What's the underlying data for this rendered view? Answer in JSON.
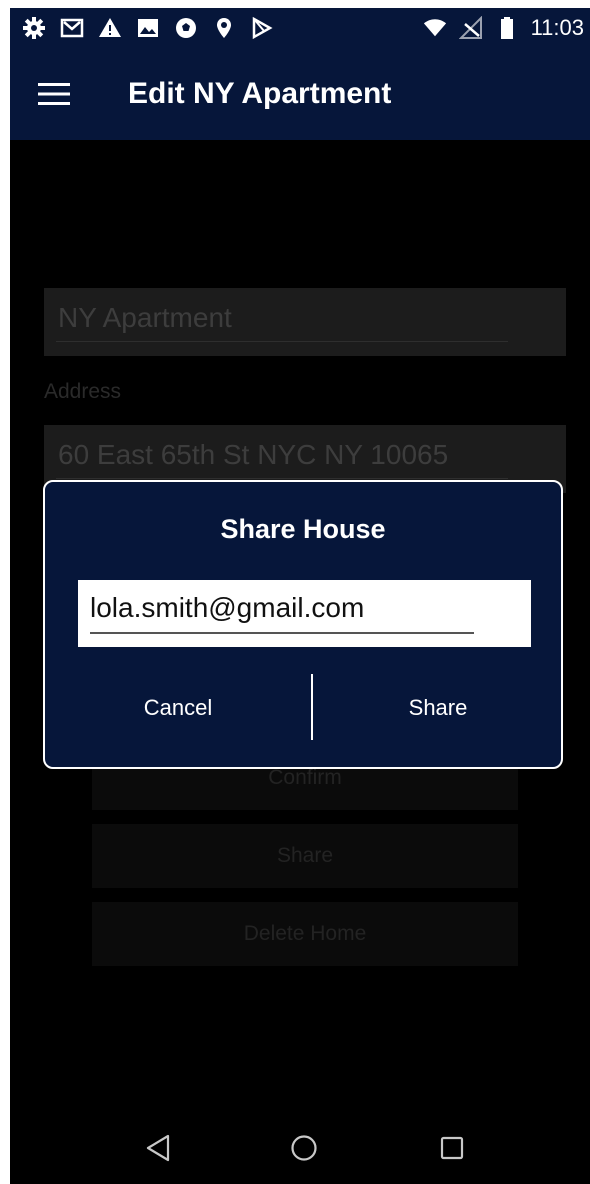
{
  "status_bar": {
    "time": "11:03",
    "left_icons": [
      "settings-icon",
      "gmail-icon",
      "warning-icon",
      "image-icon",
      "soccer-ball-icon",
      "location-pin-icon",
      "play-store-icon"
    ],
    "right_icons": [
      "wifi-icon",
      "no-signal-icon",
      "battery-icon"
    ]
  },
  "app_bar": {
    "title": "Edit NY Apartment",
    "menu_icon": "hamburger-menu-icon"
  },
  "form": {
    "name_value": "NY Apartment",
    "address_label": "Address",
    "address_value": "60 East 65th St NYC NY 10065",
    "confirm_label": "Confirm",
    "share_label": "Share",
    "delete_label": "Delete Home"
  },
  "dialog": {
    "title": "Share House",
    "email_value": "lola.smith@gmail.com",
    "cancel_label": "Cancel",
    "share_label": "Share"
  },
  "nav_bar": {
    "icons": [
      "back-icon",
      "home-icon",
      "recents-icon"
    ]
  },
  "colors": {
    "primary_dark": "#06163a",
    "dialog_border": "#ffffff",
    "background": "#000000"
  }
}
